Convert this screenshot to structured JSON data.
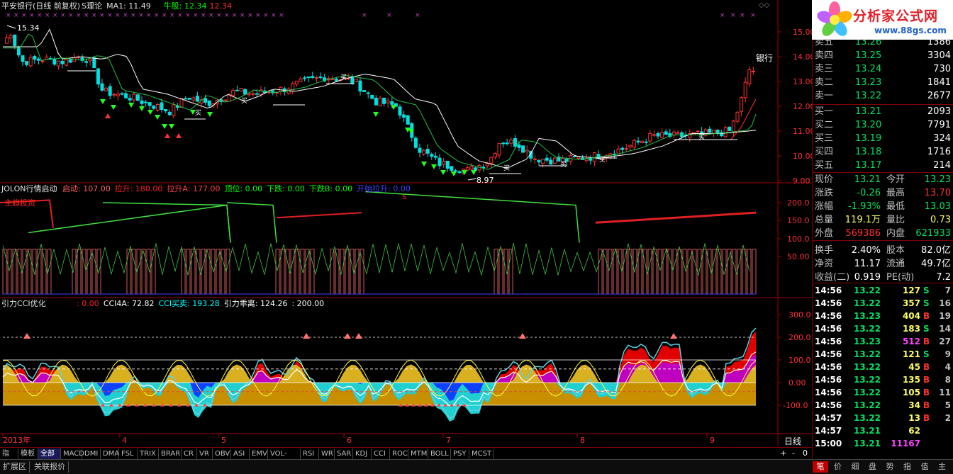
{
  "stock_title": "平安银行(日线 前复权)",
  "indicator1": "S理论",
  "ma_label": "MA1: 11.49",
  "bull_label": "牛股: 12.34",
  "bull_value2": "12.34",
  "price_high_label": "15.34",
  "price_low_label": "8.97",
  "sector_label": "银行",
  "buy_marker": "买",
  "s_marker": "S",
  "panel2": {
    "name": "JOLON行情启动",
    "items": [
      {
        "label": "启动: 107.00",
        "color": "#ff6060"
      },
      {
        "label": "拉升: 180.00",
        "color": "#ff2020"
      },
      {
        "label": "拉升A: 177.00",
        "color": "#ff4040"
      },
      {
        "label": "顶位: 0.00",
        "color": "#00ff00"
      },
      {
        "label": "下跌: 0.00",
        "color": "#00ff00"
      },
      {
        "label": "下跌B: 0.00",
        "color": "#00ff00"
      },
      {
        "label": "开始拉升: 0.00",
        "color": "#4040ff"
      }
    ],
    "marker": "主趋投资"
  },
  "panel3": {
    "name": "引力CCI优化",
    "items": [
      {
        "label": ": 0.00",
        "color": "#ff2020"
      },
      {
        "label": "CCI4A: 72.82",
        "color": "#ffffff"
      },
      {
        "label": "CCI买卖: 193.28",
        "color": "#00ffff"
      },
      {
        "label": "引力乖离: 124.26",
        "color": "#ffffff"
      },
      {
        "label": ": 200.00",
        "color": "#ffffff"
      }
    ]
  },
  "axis1": [
    "15.00",
    "14.00",
    "13.00",
    "12.00",
    "11.00",
    "10.00",
    "9.00"
  ],
  "axis2": [
    "200.0",
    "150.0",
    "100.0",
    "50.00"
  ],
  "axis3": [
    "300.0",
    "200.0",
    "100.0",
    "0.00",
    "-100.0"
  ],
  "xaxis": [
    "2013年",
    "4",
    "5",
    "6",
    "7",
    "8",
    "9"
  ],
  "period_label": "日线",
  "zoom_controls": {
    "plus": "+",
    "minus": "-",
    "zero": "0"
  },
  "tabs": [
    "指标",
    "模板",
    "全部",
    "MACD",
    "DMI",
    "DMA",
    "FSL",
    "TRIX",
    "BRAR",
    "CR",
    "VR",
    "OBV",
    "ASI",
    "EMV",
    "VOL-TDX",
    "RSI",
    "WR",
    "SAR",
    "KDJ",
    "CCI",
    "ROC",
    "MTM",
    "BOLL",
    "PSY",
    "MCST"
  ],
  "bottom_tabs": [
    "扩展区",
    "关联报价"
  ],
  "right_tabs": [
    "笔",
    "价",
    "细",
    "盘",
    "势",
    "指",
    "值",
    "主"
  ],
  "logo": {
    "text": "分析家公式网",
    "url": "www.88gs.com"
  },
  "orderbook_sell": [
    {
      "label": "卖五",
      "price": "13.26",
      "vol": "1386"
    },
    {
      "label": "卖四",
      "price": "13.25",
      "vol": "3304"
    },
    {
      "label": "卖三",
      "price": "13.24",
      "vol": "730"
    },
    {
      "label": "卖二",
      "price": "13.23",
      "vol": "1841"
    },
    {
      "label": "卖一",
      "price": "13.22",
      "vol": "2677"
    }
  ],
  "orderbook_buy": [
    {
      "label": "买一",
      "price": "13.21",
      "vol": "2093"
    },
    {
      "label": "买二",
      "price": "13.20",
      "vol": "7791"
    },
    {
      "label": "买三",
      "price": "13.19",
      "vol": "324"
    },
    {
      "label": "买四",
      "price": "13.18",
      "vol": "1716"
    },
    {
      "label": "买五",
      "price": "13.17",
      "vol": "214"
    }
  ],
  "quote": [
    {
      "l1": "现价",
      "v1": "13.21",
      "c1": "#00e060",
      "l2": "今开",
      "v2": "13.23",
      "c2": "#00e060"
    },
    {
      "l1": "涨跌",
      "v1": "-0.26",
      "c1": "#00e060",
      "l2": "最高",
      "v2": "13.70",
      "c2": "#ff3030"
    },
    {
      "l1": "涨幅",
      "v1": "-1.93%",
      "c1": "#00e060",
      "l2": "最低",
      "v2": "13.03",
      "c2": "#00e060"
    },
    {
      "l1": "总量",
      "v1": "119.1万",
      "c1": "#ffff60",
      "l2": "量比",
      "v2": "0.73",
      "c2": "#ffff60"
    },
    {
      "l1": "外盘",
      "v1": "569386",
      "c1": "#ff3030",
      "l2": "内盘",
      "v2": "621933",
      "c2": "#00e060"
    },
    {
      "l1": "换手",
      "v1": "2.40%",
      "c1": "#ffffff",
      "l2": "股本",
      "v2": "82.0亿",
      "c2": "#ffffff"
    },
    {
      "l1": "净资",
      "v1": "11.17",
      "c1": "#ffffff",
      "l2": "流通",
      "v2": "49.7亿",
      "c2": "#ffffff"
    },
    {
      "l1": "收益(二)",
      "v1": "0.919",
      "c1": "#ffffff",
      "l2": "PE(动)",
      "v2": "7.2",
      "c2": "#ffffff"
    }
  ],
  "ticks": [
    {
      "t": "14:56",
      "p": "13.22",
      "pc": "#00e060",
      "v": "127",
      "vc": "#ffff60",
      "d": "S",
      "dc": "#00e060",
      "n": "7"
    },
    {
      "t": "14:56",
      "p": "13.22",
      "pc": "#00e060",
      "v": "357",
      "vc": "#ffff60",
      "d": "S",
      "dc": "#00e060",
      "n": "16"
    },
    {
      "t": "14:56",
      "p": "13.23",
      "pc": "#00e060",
      "v": "404",
      "vc": "#ffff60",
      "d": "B",
      "dc": "#ff3030",
      "n": "19"
    },
    {
      "t": "14:56",
      "p": "13.22",
      "pc": "#00e060",
      "v": "183",
      "vc": "#ffff60",
      "d": "S",
      "dc": "#00e060",
      "n": "14"
    },
    {
      "t": "14:56",
      "p": "13.23",
      "pc": "#00e060",
      "v": "512",
      "vc": "#ff40ff",
      "d": "B",
      "dc": "#ff3030",
      "n": "27"
    },
    {
      "t": "14:56",
      "p": "13.22",
      "pc": "#00e060",
      "v": "121",
      "vc": "#ffff60",
      "d": "S",
      "dc": "#00e060",
      "n": "9"
    },
    {
      "t": "14:56",
      "p": "13.22",
      "pc": "#00e060",
      "v": "45",
      "vc": "#ffff60",
      "d": "B",
      "dc": "#ff3030",
      "n": "4"
    },
    {
      "t": "14:56",
      "p": "13.22",
      "pc": "#00e060",
      "v": "135",
      "vc": "#ffff60",
      "d": "B",
      "dc": "#ff3030",
      "n": "8"
    },
    {
      "t": "14:56",
      "p": "13.22",
      "pc": "#00e060",
      "v": "105",
      "vc": "#ffff60",
      "d": "B",
      "dc": "#ff3030",
      "n": "11"
    },
    {
      "t": "14:56",
      "p": "13.22",
      "pc": "#00e060",
      "v": "34",
      "vc": "#ffff60",
      "d": "B",
      "dc": "#ff3030",
      "n": "5"
    },
    {
      "t": "14:57",
      "p": "13.22",
      "pc": "#00e060",
      "v": "13",
      "vc": "#ffff60",
      "d": "B",
      "dc": "#ff3030",
      "n": "2"
    },
    {
      "t": "14:57",
      "p": "13.21",
      "pc": "#00e060",
      "v": "62",
      "vc": "#ffff60",
      "d": "",
      "dc": "#ff3030",
      "n": ""
    },
    {
      "t": "15:00",
      "p": "13.21",
      "pc": "#00e060",
      "v": "11167",
      "vc": "#ff40ff",
      "d": "",
      "dc": "#ff3030",
      "n": ""
    }
  ]
}
